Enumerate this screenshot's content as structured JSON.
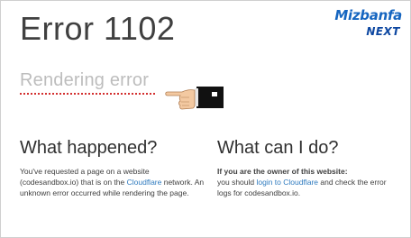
{
  "title": "Error 1102",
  "logo": {
    "brand": "Mizbanfa",
    "sub": "NEXT",
    "colors": {
      "primary": "#1565c0",
      "secondary": "#0d47a1"
    }
  },
  "subtitle": "Rendering error",
  "pointer_icon": "pointing-hand-icon",
  "left_column": {
    "heading": "What happened?",
    "text_1": "You've requested a page on a website (codesandbox.io) that is on the ",
    "link": "Cloudflare",
    "text_2": " network. An unknown error occurred while rendering the page."
  },
  "right_column": {
    "heading": "What can I do?",
    "owner_label": "If you are the owner of this website:",
    "text_1": "you should ",
    "link": "login to Cloudflare",
    "text_2": " and check the error logs for codesandbox.io."
  },
  "colors": {
    "link": "#2f7bbf",
    "underline": "#d32f2f",
    "muted": "#bdbdbd"
  }
}
